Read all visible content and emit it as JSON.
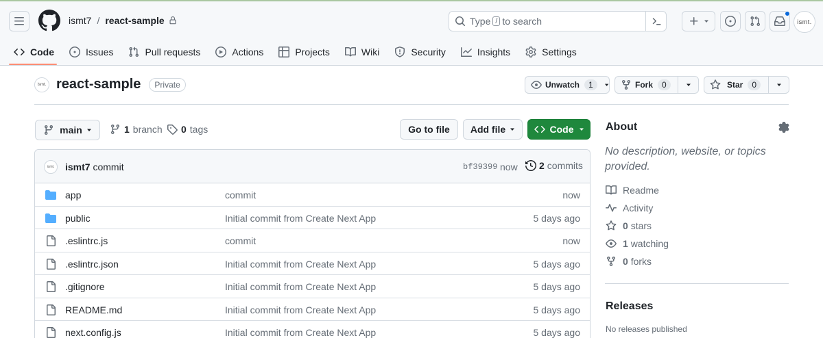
{
  "header": {
    "owner": "ismt7",
    "separator": "/",
    "repo": "react-sample",
    "search_prefix": "Type",
    "search_key": "/",
    "search_suffix": "to search",
    "avatar_text": "ismt."
  },
  "tabs": [
    {
      "label": "Code",
      "icon": "code-icon",
      "selected": true
    },
    {
      "label": "Issues",
      "icon": "issue-icon"
    },
    {
      "label": "Pull requests",
      "icon": "pull-request-icon"
    },
    {
      "label": "Actions",
      "icon": "play-icon"
    },
    {
      "label": "Projects",
      "icon": "table-icon"
    },
    {
      "label": "Wiki",
      "icon": "book-icon"
    },
    {
      "label": "Security",
      "icon": "shield-icon"
    },
    {
      "label": "Insights",
      "icon": "graph-icon"
    },
    {
      "label": "Settings",
      "icon": "gear-icon"
    }
  ],
  "repo": {
    "name": "react-sample",
    "visibility": "Private",
    "avatar_text": "ismt.",
    "unwatch_label": "Unwatch",
    "watch_count": "1",
    "fork_label": "Fork",
    "fork_count": "0",
    "star_label": "Star",
    "star_count": "0"
  },
  "branchbar": {
    "branch": "main",
    "branch_count": "1",
    "branch_word": "branch",
    "tag_count": "0",
    "tag_word": "tags",
    "goto_file": "Go to file",
    "add_file": "Add file",
    "code": "Code"
  },
  "latest_commit": {
    "author": "ismt7",
    "message": "commit",
    "sha": "bf39399",
    "when": "now",
    "commit_count": "2",
    "commit_word": "commits"
  },
  "files": [
    {
      "name": "app",
      "type": "dir",
      "message": "commit",
      "age": "now"
    },
    {
      "name": "public",
      "type": "dir",
      "message": "Initial commit from Create Next App",
      "age": "5 days ago"
    },
    {
      "name": ".eslintrc.js",
      "type": "file",
      "message": "commit",
      "age": "now"
    },
    {
      "name": ".eslintrc.json",
      "type": "file",
      "message": "Initial commit from Create Next App",
      "age": "5 days ago"
    },
    {
      "name": ".gitignore",
      "type": "file",
      "message": "Initial commit from Create Next App",
      "age": "5 days ago"
    },
    {
      "name": "README.md",
      "type": "file",
      "message": "Initial commit from Create Next App",
      "age": "5 days ago"
    },
    {
      "name": "next.config.js",
      "type": "file",
      "message": "Initial commit from Create Next App",
      "age": "5 days ago"
    }
  ],
  "about": {
    "title": "About",
    "description": "No description, website, or topics provided.",
    "readme": "Readme",
    "activity": "Activity",
    "stars_count": "0",
    "stars_word": "stars",
    "watching_count": "1",
    "watching_word": "watching",
    "forks_count": "0",
    "forks_word": "forks"
  },
  "releases": {
    "title": "Releases",
    "none": "No releases published"
  },
  "colors": {
    "accent_green": "#1f883d",
    "tab_underline": "#fd8c73",
    "folder_blue": "#54aeff",
    "notification_blue": "#0969da"
  }
}
